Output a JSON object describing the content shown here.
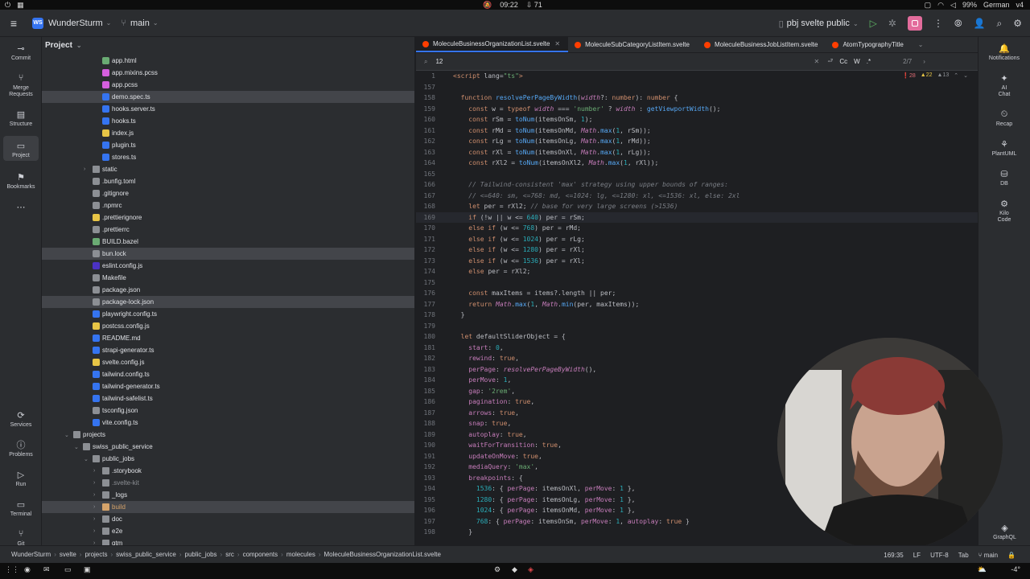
{
  "system": {
    "time": "09:22",
    "notifications": "71",
    "battery": "99%",
    "keyboard": "German",
    "layout_num": "v4"
  },
  "titlebar": {
    "project_badge": "WS",
    "project_name": "WunderSturm",
    "branch": "main",
    "run_config": "pbj svelte public"
  },
  "leftstrip": [
    {
      "name": "commit",
      "label": "Commit",
      "icon": "⊸"
    },
    {
      "name": "merge-requests",
      "label": "Merge\nRequests",
      "icon": "⑂"
    },
    {
      "name": "structure",
      "label": "Structure",
      "icon": "▤"
    },
    {
      "name": "project",
      "label": "Project",
      "icon": "▭"
    },
    {
      "name": "bookmarks",
      "label": "Bookmarks",
      "icon": "⚑"
    },
    {
      "name": "more",
      "label": "",
      "icon": "⋯"
    }
  ],
  "leftstrip_bottom": [
    {
      "name": "services",
      "label": "Services",
      "icon": "⟳"
    },
    {
      "name": "problems",
      "label": "Problems",
      "icon": "ⓘ"
    },
    {
      "name": "run",
      "label": "Run",
      "icon": "▷"
    },
    {
      "name": "terminal",
      "label": "Terminal",
      "icon": "▭"
    },
    {
      "name": "git",
      "label": "Git",
      "icon": "⑂"
    }
  ],
  "project_panel": {
    "title": "Project",
    "rows": [
      {
        "label": "app.html",
        "indent": 5,
        "color": "#6aab73",
        "type": "file"
      },
      {
        "label": "app.mixins.pcss",
        "indent": 5,
        "color": "#d55fde",
        "type": "file"
      },
      {
        "label": "app.pcss",
        "indent": 5,
        "color": "#d55fde",
        "type": "file"
      },
      {
        "label": "demo.spec.ts",
        "indent": 5,
        "color": "#3574f0",
        "type": "file",
        "sel": true
      },
      {
        "label": "hooks.server.ts",
        "indent": 5,
        "color": "#3574f0",
        "type": "file"
      },
      {
        "label": "hooks.ts",
        "indent": 5,
        "color": "#3574f0",
        "type": "file"
      },
      {
        "label": "index.js",
        "indent": 5,
        "color": "#e8c546",
        "type": "file"
      },
      {
        "label": "plugin.ts",
        "indent": 5,
        "color": "#3574f0",
        "type": "file"
      },
      {
        "label": "stores.ts",
        "indent": 5,
        "color": "#3574f0",
        "type": "file"
      },
      {
        "label": "static",
        "indent": 4,
        "color": "#8c8f94",
        "type": "folder",
        "chev": "›"
      },
      {
        "label": ".bunfig.toml",
        "indent": 4,
        "color": "#8c8f94",
        "type": "file"
      },
      {
        "label": ".gitignore",
        "indent": 4,
        "color": "#8c8f94",
        "type": "file"
      },
      {
        "label": ".npmrc",
        "indent": 4,
        "color": "#8c8f94",
        "type": "file"
      },
      {
        "label": ".prettierignore",
        "indent": 4,
        "color": "#e8c546",
        "type": "file"
      },
      {
        "label": ".prettierrc",
        "indent": 4,
        "color": "#8c8f94",
        "type": "file"
      },
      {
        "label": "BUILD.bazel",
        "indent": 4,
        "color": "#6aab73",
        "type": "file"
      },
      {
        "label": "bun.lock",
        "indent": 4,
        "color": "#8c8f94",
        "type": "file",
        "sel": true
      },
      {
        "label": "eslint.config.js",
        "indent": 4,
        "color": "#4b32c3",
        "type": "file"
      },
      {
        "label": "Makefile",
        "indent": 4,
        "color": "#8c8f94",
        "type": "file"
      },
      {
        "label": "package.json",
        "indent": 4,
        "color": "#8c8f94",
        "type": "file"
      },
      {
        "label": "package-lock.json",
        "indent": 4,
        "color": "#8c8f94",
        "type": "file",
        "sel": true
      },
      {
        "label": "playwright.config.ts",
        "indent": 4,
        "color": "#3574f0",
        "type": "file"
      },
      {
        "label": "postcss.config.js",
        "indent": 4,
        "color": "#e8c546",
        "type": "file"
      },
      {
        "label": "README.md",
        "indent": 4,
        "color": "#3574f0",
        "type": "file"
      },
      {
        "label": "strapi-generator.ts",
        "indent": 4,
        "color": "#3574f0",
        "type": "file"
      },
      {
        "label": "svelte.config.js",
        "indent": 4,
        "color": "#e8c546",
        "type": "file"
      },
      {
        "label": "tailwind.config.ts",
        "indent": 4,
        "color": "#3574f0",
        "type": "file"
      },
      {
        "label": "tailwind-generator.ts",
        "indent": 4,
        "color": "#3574f0",
        "type": "file"
      },
      {
        "label": "tailwind-safelist.ts",
        "indent": 4,
        "color": "#3574f0",
        "type": "file"
      },
      {
        "label": "tsconfig.json",
        "indent": 4,
        "color": "#8c8f94",
        "type": "file"
      },
      {
        "label": "vite.config.ts",
        "indent": 4,
        "color": "#3574f0",
        "type": "file"
      },
      {
        "label": "projects",
        "indent": 2,
        "color": "#8c8f94",
        "type": "folder",
        "chev": "⌄"
      },
      {
        "label": "swiss_public_service",
        "indent": 3,
        "color": "#8c8f94",
        "type": "folder",
        "chev": "⌄"
      },
      {
        "label": "public_jobs",
        "indent": 4,
        "color": "#8c8f94",
        "type": "folder",
        "chev": "⌄"
      },
      {
        "label": ".storybook",
        "indent": 5,
        "color": "#8c8f94",
        "type": "folder",
        "chev": "›"
      },
      {
        "label": ".svelte-kit",
        "indent": 5,
        "color": "#8c8f94",
        "type": "folder",
        "chev": "›",
        "dim": true
      },
      {
        "label": "_logs",
        "indent": 5,
        "color": "#8c8f94",
        "type": "folder",
        "chev": "›"
      },
      {
        "label": "build",
        "indent": 5,
        "color": "#d5a36a",
        "type": "folder",
        "chev": "›",
        "orange": true,
        "sel": true
      },
      {
        "label": "doc",
        "indent": 5,
        "color": "#8c8f94",
        "type": "folder",
        "chev": "›"
      },
      {
        "label": "e2e",
        "indent": 5,
        "color": "#8c8f94",
        "type": "folder",
        "chev": "›"
      },
      {
        "label": "qtm",
        "indent": 5,
        "color": "#8c8f94",
        "type": "folder",
        "chev": "›"
      }
    ]
  },
  "editor": {
    "tabs": [
      {
        "label": "MoleculeBusinessOrganizationList.svelte",
        "active": true
      },
      {
        "label": "MoleculeSubCategoryListItem.svelte",
        "active": false
      },
      {
        "label": "MoleculeBusinessJobListItem.svelte",
        "active": false
      },
      {
        "label": "AtomTypographyTitle",
        "active": false
      }
    ],
    "find": {
      "query": "12",
      "match_count": "2/7",
      "cc": "Cc",
      "w": "W",
      "regex": ".*"
    },
    "inspections": {
      "errors": "28",
      "warnings": "22",
      "weak": "13"
    },
    "lines": [
      {
        "n": "1",
        "html": "<span class=\"k\">&lt;script</span> <span class=\"txt\">lang=</span><span class=\"s\">\"ts\"</span><span class=\"k\">&gt;</span>"
      },
      {
        "n": "157",
        "html": ""
      },
      {
        "n": "158",
        "html": "  <span class=\"k\">function</span> <span class=\"f\">resolvePerPageByWidth</span>(<span class=\"i\">width</span>?: <span class=\"k\">number</span>): <span class=\"k\">number</span> {"
      },
      {
        "n": "159",
        "html": "    <span class=\"k\">const</span> w = <span class=\"k\">typeof</span> <span class=\"i\">width</span> === <span class=\"s\">'number'</span> ? <span class=\"i\">width</span> : <span class=\"f\">getViewportWidth</span>();"
      },
      {
        "n": "160",
        "html": "    <span class=\"k\">const</span> rSm = <span class=\"f\">toNum</span>(itemsOnSm, <span class=\"n\">1</span>);"
      },
      {
        "n": "161",
        "html": "    <span class=\"k\">const</span> rMd = <span class=\"f\">toNum</span>(itemsOnMd, <span class=\"i\">Math</span>.<span class=\"f\">max</span>(<span class=\"n\">1</span>, rSm));"
      },
      {
        "n": "162",
        "html": "    <span class=\"k\">const</span> rLg = <span class=\"f\">toNum</span>(itemsOnLg, <span class=\"i\">Math</span>.<span class=\"f\">max</span>(<span class=\"n\">1</span>, rMd));"
      },
      {
        "n": "163",
        "html": "    <span class=\"k\">const</span> rXl = <span class=\"f\">toNum</span>(itemsOnXl, <span class=\"i\">Math</span>.<span class=\"f\">max</span>(<span class=\"n\">1</span>, rLg));"
      },
      {
        "n": "164",
        "html": "    <span class=\"k\">const</span> rXl2 = <span class=\"f\">toNum</span>(itemsOnXl2, <span class=\"i\">Math</span>.<span class=\"f\">max</span>(<span class=\"n\">1</span>, rXl));"
      },
      {
        "n": "165",
        "html": ""
      },
      {
        "n": "166",
        "html": "    <span class=\"c\">// Tailwind-consistent 'max' strategy using upper bounds of ranges:</span>"
      },
      {
        "n": "167",
        "html": "    <span class=\"c\">// &lt;=640: sm, &lt;=768: md, &lt;=1024: lg, &lt;=1280: xl, &lt;=1536: xl, else: 2xl</span>"
      },
      {
        "n": "168",
        "html": "    <span class=\"k\">let</span> per = rXl2; <span class=\"c\">// base for very large screens (&gt;1536)</span>"
      },
      {
        "n": "169",
        "html": "    <span class=\"k\">if</span> (!w || w &lt;= <span class=\"n\">640</span>) per = rSm;",
        "cur": true
      },
      {
        "n": "170",
        "html": "    <span class=\"k\">else if</span> (w &lt;= <span class=\"n\">768</span>) per = rMd;"
      },
      {
        "n": "171",
        "html": "    <span class=\"k\">else if</span> (w &lt;= <span class=\"n\">1024</span>) per = rLg;"
      },
      {
        "n": "172",
        "html": "    <span class=\"k\">else if</span> (w &lt;= <span class=\"n\">1280</span>) per = rXl;"
      },
      {
        "n": "173",
        "html": "    <span class=\"k\">else if</span> (w &lt;= <span class=\"n\">1536</span>) per = rXl;"
      },
      {
        "n": "174",
        "html": "    <span class=\"k\">else</span> per = rXl2;"
      },
      {
        "n": "175",
        "html": ""
      },
      {
        "n": "176",
        "html": "    <span class=\"k\">const</span> maxItems = items?.length || per;"
      },
      {
        "n": "177",
        "html": "    <span class=\"k\">return</span> <span class=\"i\">Math</span>.<span class=\"f\">max</span>(<span class=\"n\">1</span>, <span class=\"i\">Math</span>.<span class=\"f\">min</span>(per, maxItems));"
      },
      {
        "n": "178",
        "html": "  }"
      },
      {
        "n": "179",
        "html": ""
      },
      {
        "n": "180",
        "html": "  <span class=\"k\">let</span> defaultSliderObject = {"
      },
      {
        "n": "181",
        "html": "    <span class=\"p\">start</span>: <span class=\"n\">0</span>,"
      },
      {
        "n": "182",
        "html": "    <span class=\"p\">rewind</span>: <span class=\"k\">true</span>,"
      },
      {
        "n": "183",
        "html": "    <span class=\"p\">perPage</span>: <span class=\"i\">resolvePerPageByWidth</span>(),"
      },
      {
        "n": "184",
        "html": "    <span class=\"p\">perMove</span>: <span class=\"n\">1</span>,"
      },
      {
        "n": "185",
        "html": "    <span class=\"p\">gap</span>: <span class=\"s\">'2rem'</span>,"
      },
      {
        "n": "186",
        "html": "    <span class=\"p\">pagination</span>: <span class=\"k\">true</span>,"
      },
      {
        "n": "187",
        "html": "    <span class=\"p\">arrows</span>: <span class=\"k\">true</span>,"
      },
      {
        "n": "188",
        "html": "    <span class=\"p\">snap</span>: <span class=\"k\">true</span>,"
      },
      {
        "n": "189",
        "html": "    <span class=\"p\">autoplay</span>: <span class=\"k\">true</span>,"
      },
      {
        "n": "190",
        "html": "    <span class=\"p\">waitForTransition</span>: <span class=\"k\">true</span>,"
      },
      {
        "n": "191",
        "html": "    <span class=\"p\">updateOnMove</span>: <span class=\"k\">true</span>,"
      },
      {
        "n": "192",
        "html": "    <span class=\"p\">mediaQuery</span>: <span class=\"s\">'max'</span>,"
      },
      {
        "n": "193",
        "html": "    <span class=\"p\">breakpoints</span>: {"
      },
      {
        "n": "194",
        "html": "      <span class=\"n\">1536</span>: { <span class=\"p\">perPage</span>: itemsOnXl, <span class=\"p\">perMove</span>: <span class=\"n\">1</span> },"
      },
      {
        "n": "195",
        "html": "      <span class=\"n\">1280</span>: { <span class=\"p\">perPage</span>: itemsOnLg, <span class=\"p\">perMove</span>: <span class=\"n\">1</span> },"
      },
      {
        "n": "196",
        "html": "      <span class=\"n\">1024</span>: { <span class=\"p\">perPage</span>: itemsOnMd, <span class=\"p\">perMove</span>: <span class=\"n\">1</span> },"
      },
      {
        "n": "197",
        "html": "      <span class=\"n\">768</span>: { <span class=\"p\">perPage</span>: itemsOnSm, <span class=\"p\">perMove</span>: <span class=\"n\">1</span>, <span class=\"p\">autoplay</span>: <span class=\"k\">true</span> }"
      },
      {
        "n": "198",
        "html": "    }"
      }
    ]
  },
  "rightstrip": [
    {
      "name": "notifications",
      "label": "Notifications",
      "icon": "🔔"
    },
    {
      "name": "ai-chat",
      "label": "AI\nChat",
      "icon": "✦"
    },
    {
      "name": "recap",
      "label": "Recap",
      "icon": "⏲"
    },
    {
      "name": "plantuml",
      "label": "PlantUML",
      "icon": "⚘"
    },
    {
      "name": "db",
      "label": "DB",
      "icon": "⛁"
    },
    {
      "name": "kilo-code",
      "label": "Kilo\nCode",
      "icon": "⚙"
    }
  ],
  "rightstrip_bottom": {
    "label": "GraphQL",
    "icon": "◈"
  },
  "statusbar": {
    "breadcrumbs": [
      "WunderSturm",
      "svelte",
      "projects",
      "swiss_public_service",
      "public_jobs",
      "src",
      "components",
      "molecules",
      "MoleculeBusinessOrganizationList.svelte"
    ],
    "position": "169:35",
    "line_ending": "LF",
    "encoding": "UTF-8",
    "indent": "Tab",
    "branch": "main"
  },
  "taskbar": {
    "temp": "-4°"
  },
  "colors": {
    "accent": "#3574f0",
    "svelte": "#ff3e00",
    "bg": "#1e1f22",
    "panel": "#2b2d30"
  }
}
